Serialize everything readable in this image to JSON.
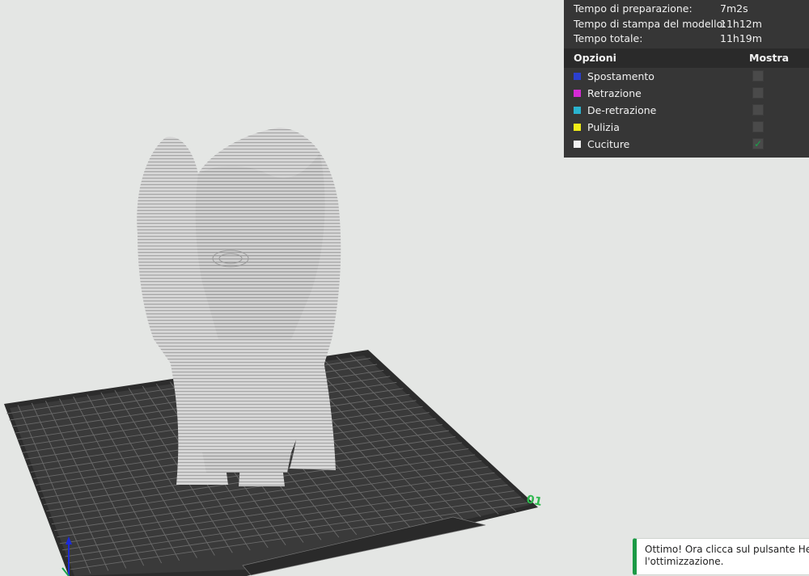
{
  "stats": {
    "rows": [
      {
        "label": "Tempo di preparazione:",
        "value": "7m2s"
      },
      {
        "label": "Tempo di stampa del modello:",
        "value": "11h12m"
      },
      {
        "label": "Tempo totale:",
        "value": "11h19m"
      }
    ]
  },
  "options": {
    "header_label": "Opzioni",
    "header_show": "Mostra",
    "items": [
      {
        "label": "Spostamento",
        "color": "#2b3fcf",
        "checked": false
      },
      {
        "label": "Retrazione",
        "color": "#d52ad5",
        "checked": false
      },
      {
        "label": "De-retrazione",
        "color": "#2ab3cf",
        "checked": false
      },
      {
        "label": "Pulizia",
        "color": "#f0ec18",
        "checked": false
      },
      {
        "label": "Cuciture",
        "color": "#f2f2f2",
        "checked": true
      }
    ]
  },
  "viewport": {
    "plate_label": "01",
    "model_color": "#d2d2d2",
    "plate_color": "#3a3a3a",
    "grid_color": "#666666"
  },
  "toast": {
    "line1": "Ottimo! Ora clicca sul pulsante Heli",
    "line2": "l'ottimizzazione."
  }
}
